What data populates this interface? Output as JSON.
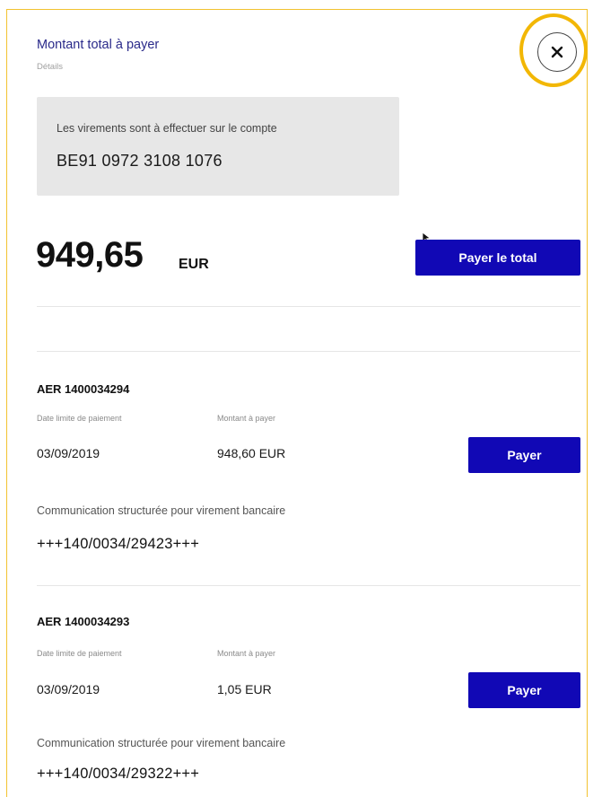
{
  "header": {
    "title": "Montant total à payer",
    "subtitle": "Détails"
  },
  "close_icon": "close-icon",
  "account": {
    "label": "Les virements sont à effectuer sur le compte",
    "iban": "BE91 0972 3108 1076"
  },
  "total": {
    "amount": "949,65",
    "currency": "EUR",
    "pay_total_label": "Payer le total"
  },
  "invoices": [
    {
      "id": "AER 1400034294",
      "due_label": "Date limite de paiement",
      "amount_label": "Montant à payer",
      "due_date": "03/09/2019",
      "amount": "948,60 EUR",
      "pay_label": "Payer",
      "communication_label": "Communication structurée pour virement bancaire",
      "communication": "+++140/0034/29423+++"
    },
    {
      "id": "AER 1400034293",
      "due_label": "Date limite de paiement",
      "amount_label": "Montant à payer",
      "due_date": "03/09/2019",
      "amount": "1,05 EUR",
      "pay_label": "Payer",
      "communication_label": "Communication structurée pour virement bancaire",
      "communication": "+++140/0034/29322+++"
    }
  ],
  "colors": {
    "primary_button": "#1108b5",
    "highlight_ring": "#f2b705",
    "title": "#2a2a8a"
  }
}
